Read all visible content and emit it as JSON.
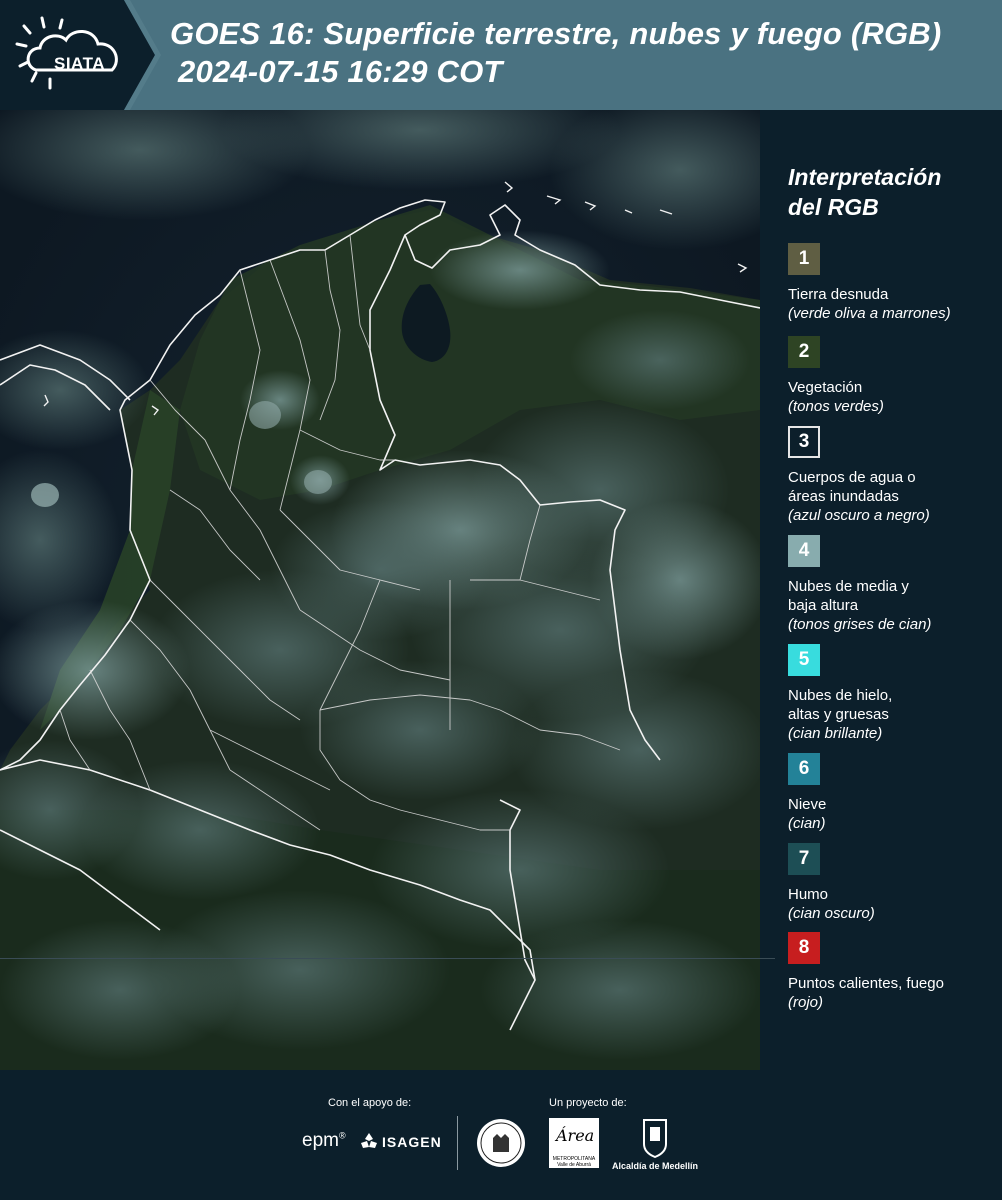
{
  "header": {
    "logo_text": "SIATA",
    "title_line1": "GOES 16: Superficie terrestre, nubes y fuego (RGB)",
    "title_line2": "2024-07-15 16:29 COT",
    "colors": {
      "dark": "#0c1f2b",
      "band": "#4a7281"
    }
  },
  "legend": {
    "title_line1": "Interpretación",
    "title_line2": "del RGB",
    "items": [
      {
        "number": "1",
        "name": "Tierra desnuda",
        "desc": "(verde oliva a marrones)",
        "color": "#5f5e43"
      },
      {
        "number": "2",
        "name": "Vegetación",
        "desc": "(tonos verdes)",
        "color": "#2e4424"
      },
      {
        "number": "3",
        "name": "Cuerpos de agua o áreas inundadas",
        "name_line1": "Cuerpos de agua o",
        "name_line2": "áreas inundadas",
        "desc": "(azul oscuro a negro)",
        "color": "#0c1f2b"
      },
      {
        "number": "4",
        "name": "Nubes de media y baja altura",
        "name_line1": "Nubes de media y",
        "name_line2": "baja altura",
        "desc": "(tonos grises de cian)",
        "color": "#88acae"
      },
      {
        "number": "5",
        "name": "Nubes de hielo, altas y gruesas",
        "name_line1": "Nubes de hielo,",
        "name_line2": "altas y gruesas",
        "desc": "(cian brillante)",
        "color": "#38dcde"
      },
      {
        "number": "6",
        "name": "Nieve",
        "desc": "(cian)",
        "color": "#238298"
      },
      {
        "number": "7",
        "name": "Humo",
        "desc": "(cian oscuro)",
        "color": "#1d4e55"
      },
      {
        "number": "8",
        "name": "Puntos calientes, fuego",
        "desc": "(rojo)",
        "color": "#c71e1f"
      }
    ]
  },
  "footer": {
    "support_label": "Con el apoyo de:",
    "project_label": "Un proyecto de:",
    "sponsor1": "epm",
    "sponsor2": "ISAGEN",
    "partner1": "Área",
    "partner1_sub": "METROPOLITANA Valle de Aburrá",
    "partner2": "Alcaldía de Medellín"
  },
  "map": {
    "icons": [
      "satellite-image",
      "country-borders",
      "department-borders"
    ]
  }
}
